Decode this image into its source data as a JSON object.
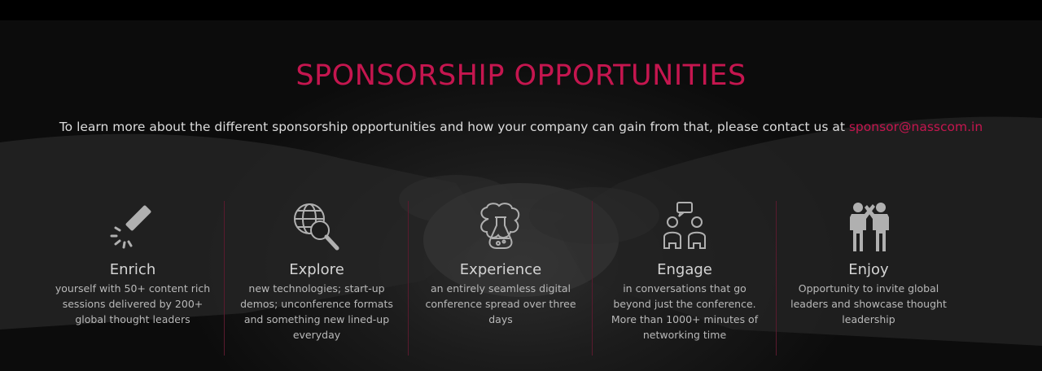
{
  "section": {
    "title": "SPONSORSHIP OPPORTUNITIES",
    "intro_text": "To learn more about the different sponsorship opportunities and how your company can gain from that, please contact us at",
    "email": "sponsor@nasscom.in"
  },
  "features": [
    {
      "name": "Enrich",
      "description": "yourself with 50+ content rich sessions delivered by 200+ global thought leaders",
      "icon": "magic-wand-icon"
    },
    {
      "name": "Explore",
      "description": "new technologies; start-up demos; unconference formats and something new lined-up everyday",
      "icon": "globe-magnifier-icon"
    },
    {
      "name": "Experience",
      "description": "an entirely seamless digital conference spread over three days",
      "icon": "brain-flask-icon"
    },
    {
      "name": "Engage",
      "description": "in conversations that go beyond just the conference. More than 1000+ minutes of networking time",
      "icon": "people-conversation-icon"
    },
    {
      "name": "Enjoy",
      "description": "Opportunity to invite global leaders and showcase thought leadership",
      "icon": "high-five-icon"
    }
  ],
  "colors": {
    "accent": "#c5164f",
    "text": "#dcdcdc",
    "icon": "#b0b0b0",
    "divider": "#5a1a2e"
  }
}
